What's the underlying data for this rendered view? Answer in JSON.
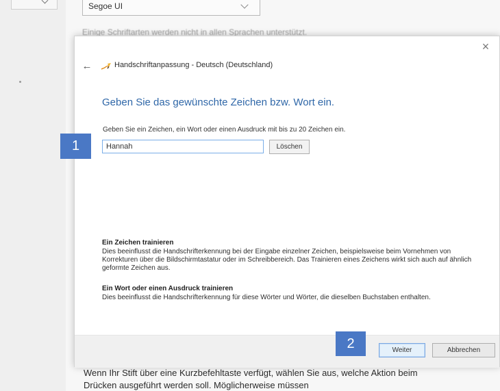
{
  "background": {
    "font_select_value": "Segoe UI",
    "font_note": "Einige Schriftarten werden nicht in allen Sprachen unterstützt.",
    "bottom_text": "Wenn Ihr Stift über eine Kurzbefehltaste verfügt, wählen Sie aus, welche Aktion beim Drücken ausgeführt werden soll. Möglicherweise müssen"
  },
  "dialog": {
    "title": "Handschriftanpassung - Deutsch (Deutschland)",
    "close_glyph": "×",
    "back_glyph": "←",
    "heading": "Geben Sie das gewünschte Zeichen bzw. Wort ein.",
    "instruction": "Geben Sie ein Zeichen, ein Wort oder einen Ausdruck mit bis zu 20 Zeichen ein.",
    "input_value": "Hannah",
    "clear_label": "Löschen",
    "train_char_title": "Ein Zeichen trainieren",
    "train_char_body": "Dies beeinflusst die Handschrifterkennung bei der Eingabe einzelner Zeichen, beispielsweise beim Vornehmen von Korrekturen über die Bildschirmtastatur oder im Schreibbereich. Das Trainieren eines Zeichens wirkt sich auch auf ähnlich geformte Zeichen aus.",
    "train_word_title": "Ein Wort oder einen Ausdruck trainieren",
    "train_word_body": "Dies beeinflusst die Handschrifterkennung für diese Wörter und Wörter, die dieselben Buchstaben enthalten.",
    "next_label": "Weiter",
    "cancel_label": "Abbrechen"
  },
  "badges": {
    "step_one": "1",
    "step_two": "2"
  },
  "colors": {
    "heading_blue": "#2f67a8",
    "badge_blue": "#4a78c5",
    "input_border": "#79aee8"
  },
  "icons": {
    "back": "arrow-left-icon",
    "close": "close-icon",
    "app": "handwriting-pen-icon",
    "dropdown": "chevron-down-icon"
  }
}
